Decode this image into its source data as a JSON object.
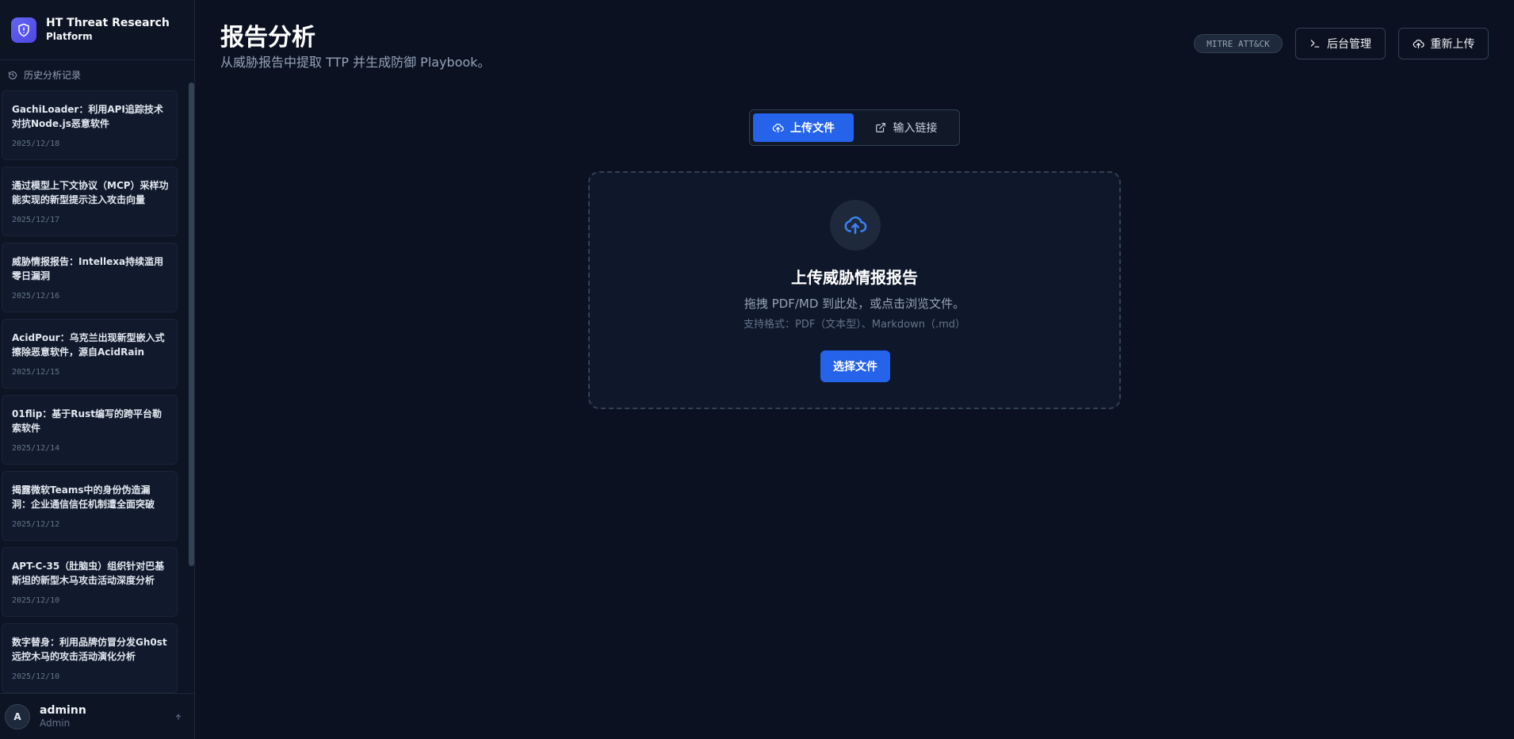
{
  "brand": {
    "title": "HT Threat Research",
    "subtitle": "Platform"
  },
  "sidebar": {
    "history_label": "历史分析记录",
    "items": [
      {
        "title": "GachiLoader：利用API追踪技术对抗Node.js恶意软件",
        "date": "2025/12/18"
      },
      {
        "title": "通过模型上下文协议（MCP）采样功能实现的新型提示注入攻击向量",
        "date": "2025/12/17"
      },
      {
        "title": "威胁情报报告：Intellexa持续滥用零日漏洞",
        "date": "2025/12/16"
      },
      {
        "title": "AcidPour：乌克兰出现新型嵌入式擦除恶意软件，源自AcidRain",
        "date": "2025/12/15"
      },
      {
        "title": "01flip：基于Rust编写的跨平台勒索软件",
        "date": "2025/12/14"
      },
      {
        "title": "揭露微软Teams中的身份伪造漏洞：企业通信信任机制遭全面突破",
        "date": "2025/12/12"
      },
      {
        "title": "APT-C-35（肚脑虫）组织针对巴基斯坦的新型木马攻击活动深度分析",
        "date": "2025/12/10"
      },
      {
        "title": "数字替身：利用品牌仿冒分发Gh0st远控木马的攻击活动演化分析",
        "date": "2025/12/10"
      }
    ]
  },
  "user": {
    "initial": "A",
    "name": "adminn",
    "role": "Admin"
  },
  "header": {
    "title": "报告分析",
    "subtitle": "从威胁报告中提取 TTP 并生成防御 Playbook。",
    "badge": "MITRE ATT&CK",
    "admin_label": "后台管理",
    "reupload_label": "重新上传"
  },
  "tabs": {
    "upload_label": "上传文件",
    "link_label": "输入链接"
  },
  "dropzone": {
    "title": "上传威胁情报报告",
    "description": "拖拽 PDF/MD 到此处，或点击浏览文件。",
    "formats": "支持格式：PDF（文本型）、Markdown（.md）",
    "button_label": "选择文件"
  },
  "colors": {
    "accent": "#2563eb",
    "background": "#0b1120",
    "brand": "#6366f1"
  }
}
